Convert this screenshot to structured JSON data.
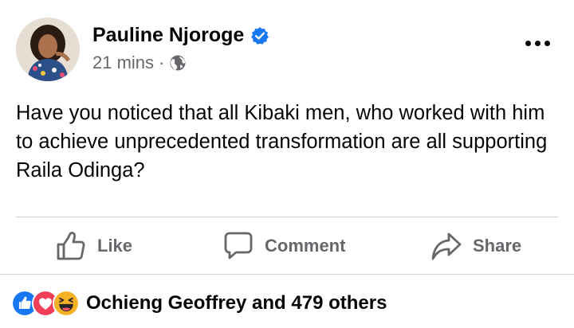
{
  "post": {
    "author": {
      "name": "Pauline Njoroge",
      "verified": true,
      "avatar": "profile-photo"
    },
    "timestamp": "21 mins",
    "separator": "·",
    "audience_icon": "globe-icon",
    "more_icon": "more-options-icon",
    "text": "Have you noticed that all Kibaki men, who worked with him to achieve unprecedented transformation are all supporting Raila Odinga?"
  },
  "actions": {
    "like": {
      "label": "Like",
      "icon": "thumbs-up-icon"
    },
    "comment": {
      "label": "Comment",
      "icon": "comment-icon"
    },
    "share": {
      "label": "Share",
      "icon": "share-icon"
    }
  },
  "reactions": {
    "icons": [
      "like-reaction-icon",
      "love-reaction-icon",
      "haha-reaction-icon"
    ],
    "summary": "Ochieng Geoffrey and 479 others"
  },
  "colors": {
    "text_primary": "#050505",
    "text_secondary": "#65676b",
    "verified_blue": "#1877f2",
    "divider": "#ced0d4",
    "like_blue": "#1877f2",
    "love_red": "#f33e58",
    "haha_yellow": "#f7b125"
  }
}
